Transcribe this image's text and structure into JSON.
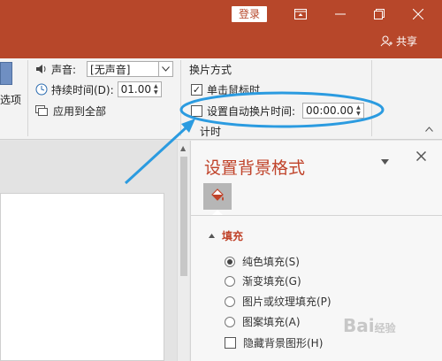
{
  "titlebar": {
    "login_label": "登录",
    "share_label": "共享",
    "bg": "#b7472a"
  },
  "ribbon": {
    "effect_options_label": "选项",
    "sound_label": "声音:",
    "sound_value": "[无声音]",
    "duration_label": "持续时间(D):",
    "duration_value": "01.00",
    "apply_all_label": "应用到全部",
    "advance_group_title": "换片方式",
    "on_click_label": "单击鼠标时",
    "on_click_checked": true,
    "auto_advance_label": "设置自动换片时间:",
    "auto_advance_checked": false,
    "auto_advance_value": "00:00.00",
    "group_footer_label": "计时"
  },
  "pane": {
    "title": "设置背景格式",
    "section_title": "填充",
    "options": [
      {
        "label": "纯色填充(S)",
        "selected": true
      },
      {
        "label": "渐变填充(G)",
        "selected": false
      },
      {
        "label": "图片或纹理填充(P)",
        "selected": false
      },
      {
        "label": "图案填充(A)",
        "selected": false
      }
    ],
    "hide_bg_label": "隐藏背景图形(H)",
    "hide_bg_checked": false
  },
  "watermark": {
    "text": "Bai",
    "suffix": "经验"
  },
  "accent": "#2b9be0"
}
